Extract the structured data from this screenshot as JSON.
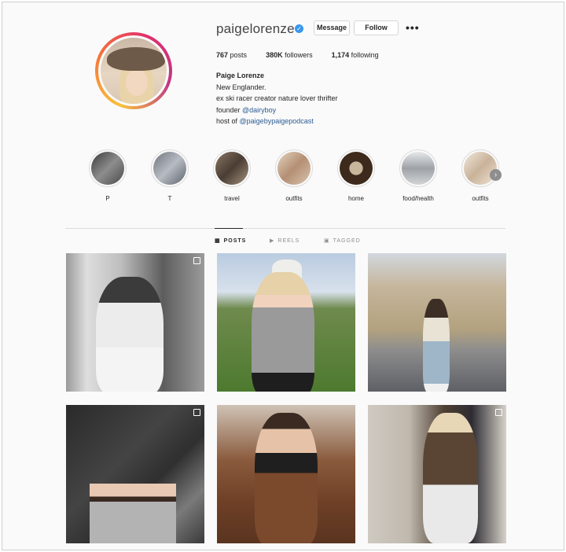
{
  "profile": {
    "username": "paigelorenze",
    "verified": true,
    "buttons": {
      "message": "Message",
      "follow": "Follow",
      "more": "•••"
    },
    "stats": [
      {
        "value": "767",
        "label": "posts"
      },
      {
        "value": "380K",
        "label": "followers"
      },
      {
        "value": "1,174",
        "label": "following"
      }
    ],
    "bio": {
      "name": "Paige Lorenze",
      "line1": "New Englander.",
      "line2": "ex ski racer creator nature lover thrifter",
      "line3_prefix": "founder ",
      "line3_link": "@dairyboy",
      "line4_prefix": "host of ",
      "line4_link": "@paigebypaigepodcast"
    }
  },
  "highlights": [
    {
      "label": "P",
      "color": "#6b6b6b"
    },
    {
      "label": "T",
      "color": "#8a8f96"
    },
    {
      "label": "travel",
      "color": "#7b6a5c"
    },
    {
      "label": "outfits",
      "color": "#c9b29a"
    },
    {
      "label": "home",
      "color": "#5a4030"
    },
    {
      "label": "food/health",
      "color": "#a9acb0"
    },
    {
      "label": "outfits",
      "color": "#d8cbb8"
    }
  ],
  "tabs": [
    {
      "label": "POSTS",
      "icon": "grid-icon"
    },
    {
      "label": "REELS",
      "icon": "reels-icon"
    },
    {
      "label": "TAGGED",
      "icon": "tagged-icon"
    }
  ],
  "colors": {
    "link": "#2b5b93",
    "verified": "#3897f0"
  }
}
